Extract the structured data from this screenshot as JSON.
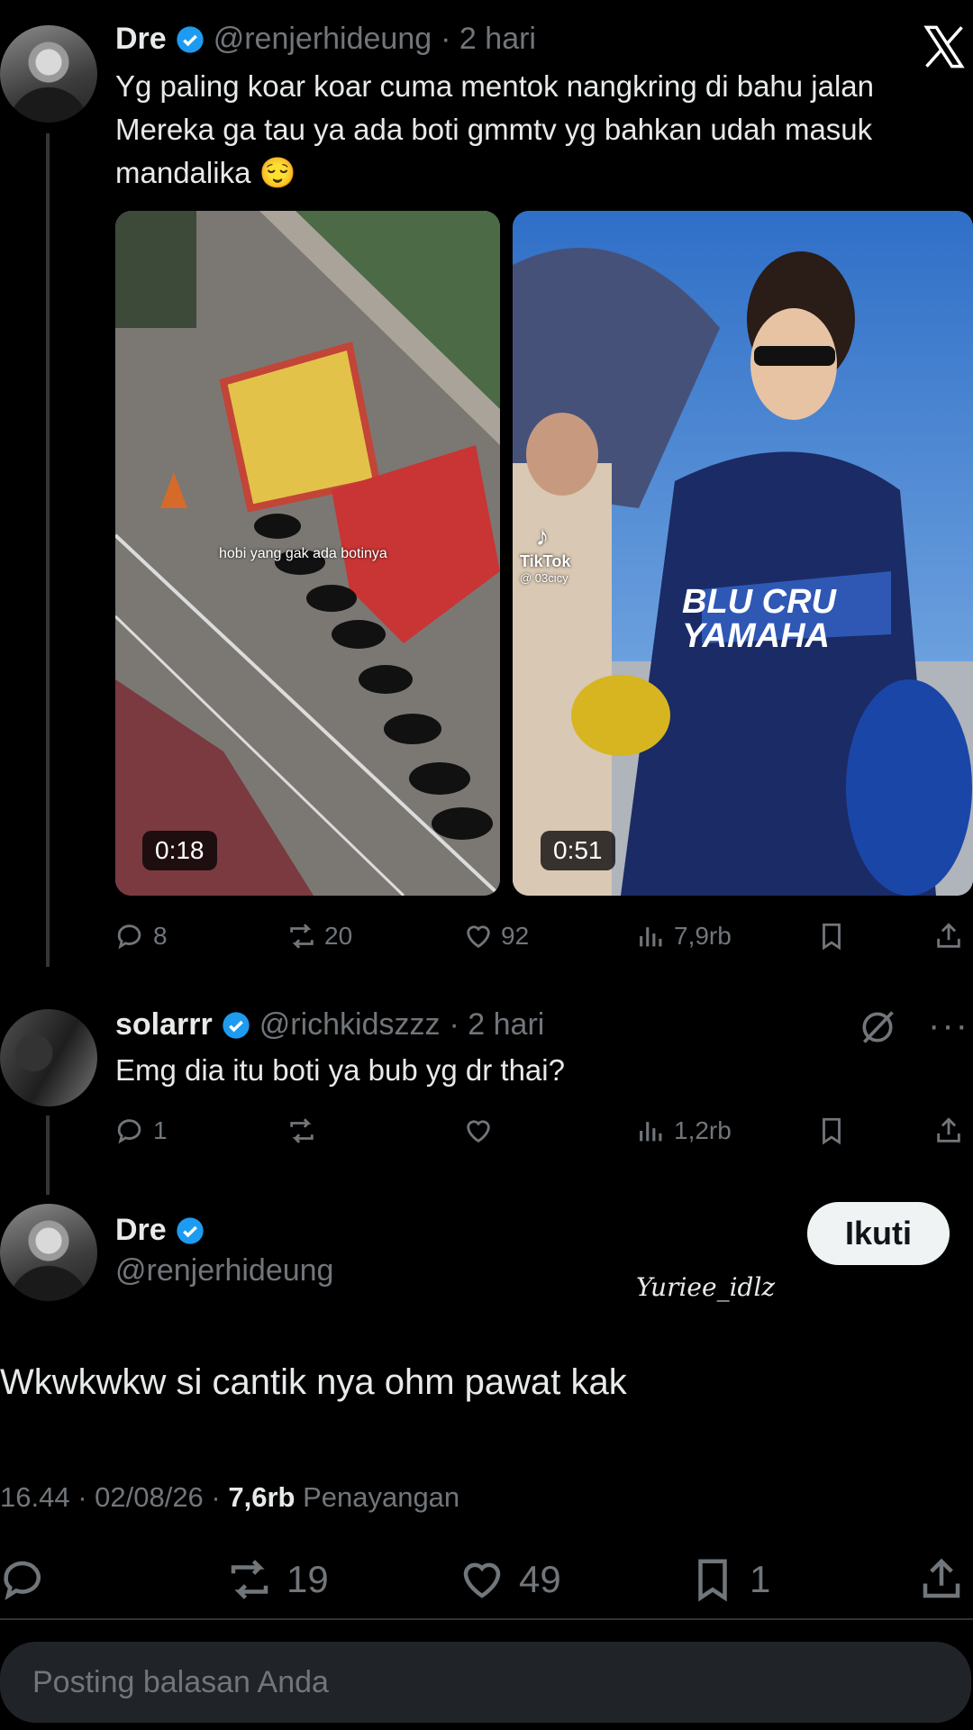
{
  "tweet1": {
    "name": "Dre",
    "handle": "@renjerhideung",
    "time": "· 2 hari",
    "lines": [
      "Yg paling koar koar cuma mentok nangkring di bahu jalan",
      "Mereka ga tau ya ada boti gmmtv yg bahkan udah masuk",
      "mandalika 😌"
    ],
    "media": [
      {
        "duration": "0:18",
        "caption": "hobi yang gak ada botinya"
      },
      {
        "duration": "0:51",
        "watermark": "TikTok",
        "watermark_user": "@ 03cicy",
        "suit_text": "BLU CRU YAMAHA"
      }
    ],
    "actions": {
      "replies": "8",
      "reposts": "20",
      "likes": "92",
      "views": "7,9rb"
    }
  },
  "tweet2": {
    "name": "solarrr",
    "handle": "@richkidszzz",
    "time": "· 2 hari",
    "text": "Emg dia itu boti ya bub yg dr thai?",
    "actions": {
      "replies": "1",
      "reposts": "",
      "likes": "",
      "views": "1,2rb"
    }
  },
  "main_tweet": {
    "name": "Dre",
    "handle": "@renjerhideung",
    "follow_label": "Ikuti",
    "text": "Wkwkwkw si cantik nya ohm pawat kak",
    "time": "16.44 · 02/08/26 · ",
    "views_count": "7,6rb",
    "views_label": " Penayangan",
    "actions": {
      "replies": "",
      "reposts": "19",
      "likes": "49",
      "bookmarks": "1"
    }
  },
  "watermark_text": "Yuriee_idlz",
  "reply_placeholder": "Posting balasan Anda",
  "colors": {
    "verified": "#1d9bf0",
    "muted": "#71767b",
    "text": "#e7e9ea",
    "bg": "#000000"
  },
  "icons": [
    "x-logo-icon",
    "verified-icon",
    "reply-icon",
    "repost-icon",
    "like-icon",
    "views-icon",
    "bookmark-icon",
    "share-icon",
    "grok-icon",
    "more-icon"
  ]
}
